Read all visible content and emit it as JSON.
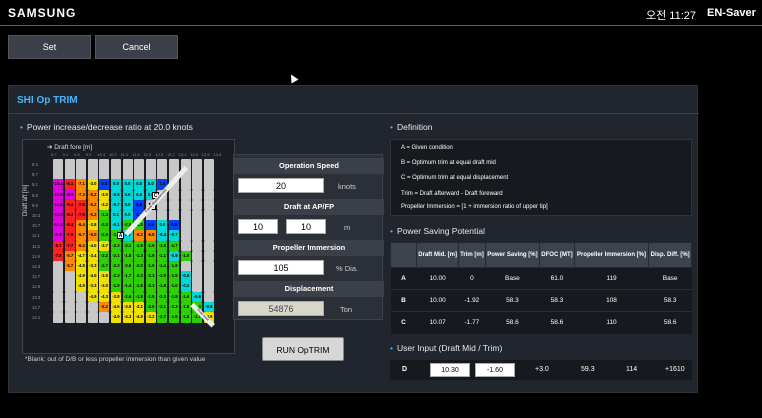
{
  "topbar": {
    "brand": "SAMSUNG",
    "clock": "오전 11:27",
    "app_name": "EN-Saver"
  },
  "actions": {
    "set_label": "Set",
    "cancel_label": "Cancel"
  },
  "panel": {
    "title": "SHI Op TRIM",
    "power_section_title": "Power increase/decrease ratio  at 20.0 knots",
    "definition_title": "Definition",
    "saving_title": "Power Saving Potential",
    "user_title": "User Input (Draft Mid / Trim)"
  },
  "grid": {
    "draft_fore_label": "Draft fore [m]",
    "draft_aft_label": "Draft aft [m]",
    "col_headers": [
      "8.7",
      "9.1",
      "9.5",
      "9.9",
      "10.3",
      "10.7",
      "11.1",
      "11.5",
      "11.9",
      "12.3",
      "12.7",
      "13.1",
      "13.5",
      "13.9",
      "14.3"
    ],
    "row_headers": [
      "8.3",
      "8.7",
      "9.1",
      "9.5",
      "9.9",
      "10.3",
      "10.7",
      "11.1",
      "11.5",
      "11.9",
      "12.3",
      "12.7",
      "12.9",
      "13.3",
      "13.7",
      "14.1"
    ],
    "cells": [
      [
        "",
        "",
        "",
        "",
        "",
        "",
        "",
        "",
        "",
        "",
        "",
        "",
        "",
        "",
        ""
      ],
      [
        "",
        "",
        "",
        "",
        "",
        "",
        "",
        "",
        "",
        "",
        "",
        "",
        "",
        "",
        ""
      ],
      [
        "-10.4",
        "-8.1",
        "-7.1",
        "-3.0",
        "0.8",
        "0.0",
        "0.0",
        "0.0",
        "0.0",
        "1.8",
        "",
        "",
        "",
        "",
        ""
      ],
      [
        "-10.6",
        "-9.8",
        "-7.3",
        "-5.2",
        "-3.0",
        "-0.5",
        "0.0",
        "0.0",
        "0.0",
        "",
        "",
        "",
        "",
        "",
        ""
      ],
      [
        "-10.8",
        "-9.4",
        "-7.5",
        "-5.2",
        "-3.2",
        "-0.7",
        "0.0",
        "0.8",
        "",
        "",
        "",
        "",
        "",
        "",
        ""
      ],
      [
        "-11.0",
        "-8.3",
        "-7.5",
        "-5.2",
        "-1.4",
        "0.1",
        "0.0",
        "2.2",
        "",
        "",
        "",
        "",
        "",
        "",
        ""
      ],
      [
        "-10.2",
        "-8.4",
        "-6.4",
        "-3.8",
        "-2.0",
        "-0.1",
        "-2.0",
        "-1.0",
        "0.5",
        "0.0",
        "0.5",
        "",
        "",
        "",
        ""
      ],
      [
        "-9.8",
        "-7.9",
        "-6.7",
        "-5.0",
        "-2.9",
        "-1.6",
        "0.0",
        "-6.2",
        "-6.8",
        "-0.4",
        "-0.7",
        "",
        "",
        "",
        ""
      ],
      [
        "-8.7",
        "-7.7",
        "-6.4",
        "-4.5",
        "-3.7",
        "-2.3",
        "-2.1",
        "-1.9",
        "-1.5",
        "-1.0",
        "-1.7",
        "",
        "",
        "",
        ""
      ],
      [
        "-7.8",
        "-5.7",
        "-4.7",
        "-3.4",
        "-2.2",
        "-2.1",
        "-1.8",
        "-1.3",
        "-1.9",
        "-1.1",
        "-0.9",
        "-1.0",
        "",
        "",
        ""
      ],
      [
        "",
        "-5.7",
        "-4.8",
        "-3.3",
        "-2.7",
        "-2.3",
        "-2.6",
        "-2.0",
        "-1.5",
        "-1.4",
        "-1.9",
        "",
        "",
        "",
        ""
      ],
      [
        "",
        "",
        "-4.9",
        "-4.5",
        "-3.5",
        "-2.3",
        "-1.7",
        "-2.3",
        "-2.3",
        "-2.0",
        "-1.5",
        "-0.8",
        "",
        "",
        ""
      ],
      [
        "",
        "",
        "-4.9",
        "-3.3",
        "-3.0",
        "-1.9",
        "-1.4",
        "-1.8",
        "-2.3",
        "-1.8",
        "-1.0",
        "-0.2",
        "",
        "",
        ""
      ],
      [
        "",
        "",
        "",
        "-4.9",
        "-4.3",
        "-3.8",
        "-2.6",
        "-1.8",
        "-1.5",
        "-2.3",
        "-1.8",
        "-1.6",
        "-0.6",
        "",
        ""
      ],
      [
        "",
        "",
        "",
        "",
        "-5.2",
        "-4.6",
        "-3.9",
        "-3.2",
        "-2.9",
        "-2.1",
        "-2.3",
        "-1.8",
        "-1.4",
        "-0.8",
        ""
      ],
      [
        "",
        "",
        "",
        "",
        "",
        "-4.9",
        "-4.3",
        "-4.9",
        "-3.2",
        "-2.7",
        "-1.9",
        "-1.8",
        "-1.7",
        "-4.9",
        ""
      ]
    ],
    "markers": [
      "A",
      "B",
      "C"
    ],
    "diag_label_top": "Equal displacement",
    "diag_label_bottom": "Even keel",
    "footnote": "*Blank: out of D/B or less propeller immersion than given value"
  },
  "operation": {
    "speed_label": "Operation Speed",
    "speed_value": "20",
    "speed_unit": "knots",
    "draft_label": "Draft at AP/FP",
    "draft_ap": "10",
    "draft_fp": "10",
    "draft_unit": "m",
    "immersion_label": "Propeller Immersion",
    "immersion_value": "105",
    "immersion_unit": "% Dia.",
    "displacement_label": "Displacement",
    "displacement_value": "54876",
    "displacement_unit": "Ton",
    "run_label": "RUN OpTRIM"
  },
  "definition": {
    "a": "A = Given condition",
    "b": "B = Optimum trim at equal draft mid",
    "c": "C = Optimum trim at equal displacement",
    "trim": "Trim = Draft afterward - Draft foreward",
    "immersion": "Propeller Immersion = [1 + immersion ratio of upper tip]"
  },
  "saving_table": {
    "headers": [
      "",
      "Draft Mid. [m]",
      "Trim [m]",
      "Power Saving [%]",
      "DFOC [MT]",
      "Propeller Immersion [%]",
      "Disp. Diff. [%]"
    ],
    "rows": [
      [
        "A",
        "10.00",
        "0",
        "Base",
        "61.0",
        "119",
        "Base"
      ],
      [
        "B",
        "10.00",
        "-1.92",
        "58.3",
        "58.3",
        "108",
        "58.3"
      ],
      [
        "C",
        "10.07",
        "-1.77",
        "58.6",
        "58.6",
        "110",
        "58.6"
      ]
    ]
  },
  "user_input": {
    "label": "D",
    "draft_mid": "10.30",
    "trim": "-1.60",
    "power_saving": "+3.0",
    "dfoc": "59.3",
    "immersion": "114",
    "disp_diff": "+1610"
  },
  "colors": {
    "accent": "#48b4ff",
    "panel_bg": "#21262e",
    "magenta": "#e000e0",
    "red": "#ff2020",
    "orange": "#ff8a00",
    "yellow": "#f0e000",
    "green": "#2dd000",
    "cyan": "#00d8d8",
    "blue": "#0040ff"
  }
}
